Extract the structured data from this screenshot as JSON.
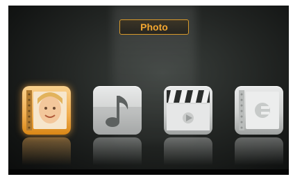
{
  "header": {
    "title": "Photo"
  },
  "menu": {
    "items": [
      {
        "id": "photo",
        "icon": "photo-album-icon",
        "selected": true
      },
      {
        "id": "music",
        "icon": "music-note-icon",
        "selected": false
      },
      {
        "id": "movie",
        "icon": "clapperboard-icon",
        "selected": false
      },
      {
        "id": "ebook",
        "icon": "ebook-icon",
        "selected": false
      }
    ]
  },
  "colors": {
    "accent": "#f2a630",
    "background": "#1c1f1d",
    "tile": "#d6d8d7"
  }
}
